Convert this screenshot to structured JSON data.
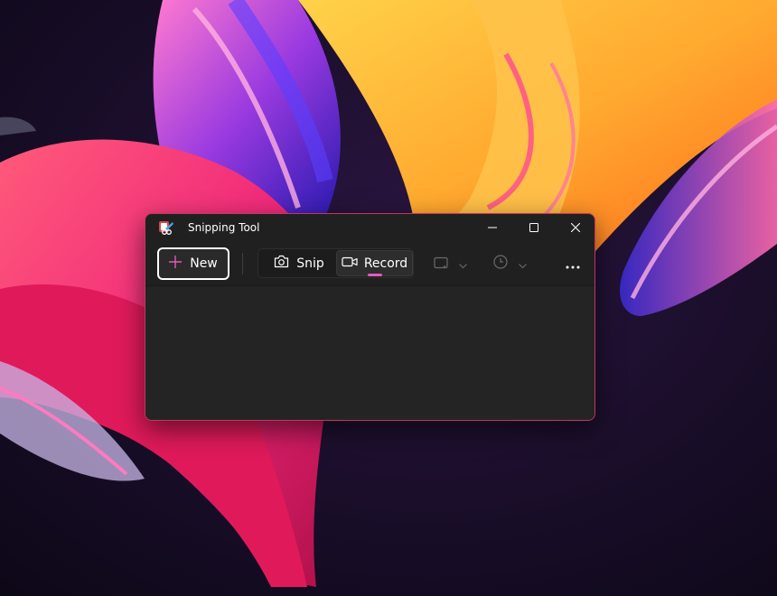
{
  "window": {
    "title": "Snipping Tool",
    "accent_color": "#c2375f"
  },
  "titlebar": {
    "icons": [
      "snipping-tool-app-icon",
      "minimize-icon",
      "maximize-icon",
      "close-icon"
    ]
  },
  "toolbar": {
    "new_label": "New",
    "new_icon": "plus-icon",
    "snip_label": "Snip",
    "snip_icon": "camera-icon",
    "record_label": "Record",
    "record_icon": "video-camera-icon",
    "selected_mode": "Record",
    "indicator_color": "#e45bbd",
    "shape_dropdown_icon": "rectangle-snip-icon",
    "delay_dropdown_icon": "clock-icon",
    "more_icon": "more-options-icon"
  }
}
